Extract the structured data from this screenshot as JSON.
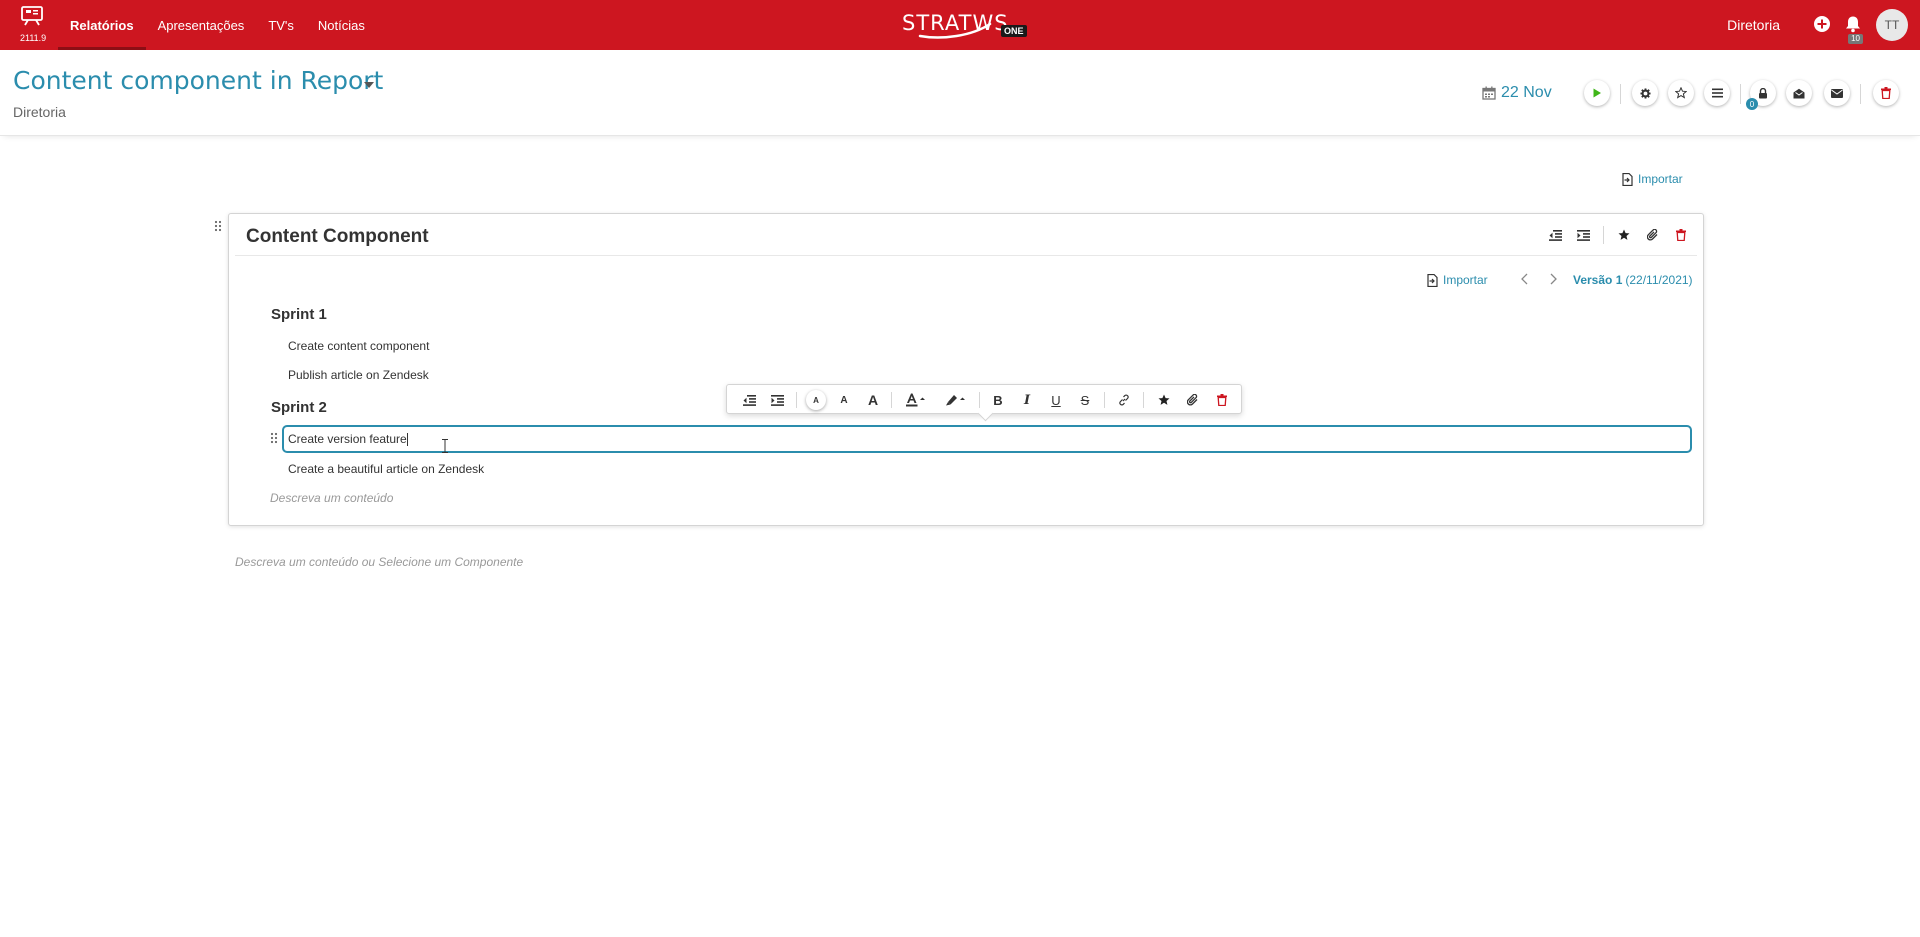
{
  "app": {
    "version": "2111.9",
    "brand": "STRATWS",
    "brand_suffix": "ONE"
  },
  "nav": {
    "items": [
      {
        "label": "Relatórios",
        "active": true
      },
      {
        "label": "Apresentações",
        "active": false
      },
      {
        "label": "TV's",
        "active": false
      },
      {
        "label": "Notícias",
        "active": false
      }
    ]
  },
  "topbar": {
    "org": "Diretoria",
    "notification_count": "10",
    "avatar_initials": "TT"
  },
  "header": {
    "title": "Content component in Report",
    "subtitle": "Diretoria",
    "date": "22 Nov",
    "lock_count": "0"
  },
  "body": {
    "import_label": "Importar",
    "bottom_placeholder": "Descreva um conteúdo ou Selecione um Componente"
  },
  "card": {
    "title": "Content Component",
    "import_label": "Importar",
    "version_label": "Versão 1",
    "version_date": "(22/11/2021)",
    "sections": [
      {
        "heading": "Sprint 1",
        "items": [
          "Create content component",
          "Publish article on Zendesk"
        ]
      },
      {
        "heading": "Sprint 2",
        "items": [
          "Create version feature",
          "Create a beautiful article on Zendesk"
        ]
      }
    ],
    "placeholder": "Descreva um conteúdo"
  },
  "toolbar": {
    "small_a": "A",
    "medium_a": "A",
    "large_a": "A",
    "bold": "B",
    "italic": "I",
    "underline": "U",
    "strike": "S"
  },
  "colors": {
    "topbar": "#cd1620",
    "accent": "#2b8dad",
    "delete": "#cd1620",
    "play": "#3fb618"
  }
}
